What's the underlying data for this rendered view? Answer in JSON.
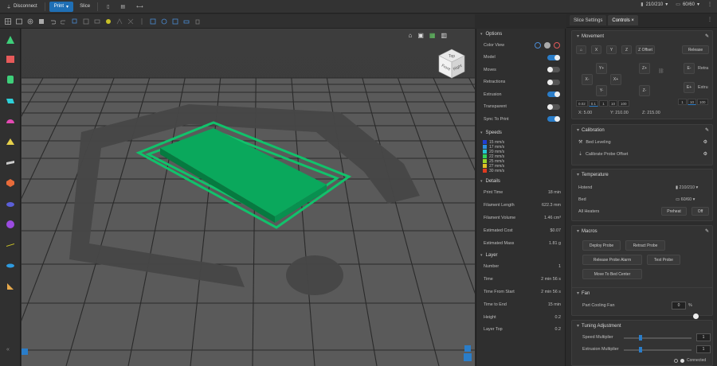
{
  "topbar": {
    "disconnect": "Disconnect",
    "print": "Print",
    "slice": "Slice",
    "hotend_temp": "210/210",
    "bed_temp": "60/60"
  },
  "options": {
    "title": "Options",
    "color_view": "Color View",
    "toggles": [
      {
        "label": "Model",
        "on": true
      },
      {
        "label": "Moves",
        "on": false
      },
      {
        "label": "Retractions",
        "on": false
      },
      {
        "label": "Extrusion",
        "on": true
      },
      {
        "label": "Transparent",
        "on": false
      },
      {
        "label": "Sync To Print",
        "on": true
      }
    ],
    "speeds_title": "Speeds",
    "speeds": [
      {
        "label": "15 mm/s",
        "color": "#1f3fd6"
      },
      {
        "label": "17 mm/s",
        "color": "#2b8fe0"
      },
      {
        "label": "20 mm/s",
        "color": "#25c7d1"
      },
      {
        "label": "22 mm/s",
        "color": "#2fd15a"
      },
      {
        "label": "25 mm/s",
        "color": "#9bd62a"
      },
      {
        "label": "27 mm/s",
        "color": "#e0c024"
      },
      {
        "label": "30 mm/s",
        "color": "#e03a1f"
      }
    ],
    "details_title": "Details",
    "details": [
      {
        "k": "Print Time",
        "v": "18 min"
      },
      {
        "k": "Filament Length",
        "v": "622.3 mm"
      },
      {
        "k": "Filament Volume",
        "v": "1.46 cm³"
      },
      {
        "k": "Estimated Cost",
        "v": "$0.07"
      },
      {
        "k": "Estimated Mass",
        "v": "1.81 g"
      }
    ],
    "layer_title": "Layer",
    "layer": [
      {
        "k": "Number",
        "v": "1"
      },
      {
        "k": "Time",
        "v": "2 min 56 s"
      },
      {
        "k": "Time From Start",
        "v": "2 min 56 s"
      },
      {
        "k": "Time to End",
        "v": "15 min"
      },
      {
        "k": "Height",
        "v": "0.2"
      },
      {
        "k": "Layer Top",
        "v": "0.2"
      }
    ]
  },
  "right": {
    "tabs": [
      "Slice Settings",
      "Controls"
    ],
    "movement": {
      "title": "Movement",
      "axes": [
        "X",
        "Y",
        "Z"
      ],
      "z_offset": "Z Offset",
      "release": "Release",
      "yplus": "Y+",
      "xminus": "X-",
      "xplus": "X+",
      "yminus": "Y-",
      "zplus": "Z+",
      "zminus": "Z-",
      "e_retract": "E-",
      "retract": "Retra",
      "e_extrude": "E+",
      "extrude": "Extru",
      "steps": [
        "0.02",
        "0.1",
        "1",
        "10",
        "100"
      ],
      "esteps": [
        "1",
        "10",
        "100"
      ],
      "x_pos": "X: 5.00",
      "y_pos": "Y: 210.00",
      "z_pos": "Z: 215.00"
    },
    "calibration": {
      "title": "Calibration",
      "bed_leveling": "Bed Leveling",
      "probe_offset": "Calibrate Probe Offset"
    },
    "temperature": {
      "title": "Temperature",
      "hotend": "Hotend",
      "hotend_val": "210/210",
      "bed": "Bed",
      "bed_val": "60/60",
      "all_heaters": "All Heaters",
      "preheat": "Preheat",
      "off": "Off"
    },
    "macros": {
      "title": "Macros",
      "items": [
        "Deploy Probe",
        "Retract Probe",
        "Release Probe Alarm",
        "Test Probe",
        "Move To Bed Center"
      ]
    },
    "fan": {
      "title": "Fan",
      "label": "Part Cooling Fan",
      "value": "0",
      "unit": "%"
    },
    "tuning": {
      "title": "Tuning Adjustment",
      "speed": "Speed Multiplier",
      "speed_val": "1",
      "extrusion": "Extrusion Multiplier",
      "extrusion_val": "1"
    },
    "status": "Connected"
  },
  "cube": {
    "top": "Top",
    "front": "Front",
    "right": "Right"
  }
}
